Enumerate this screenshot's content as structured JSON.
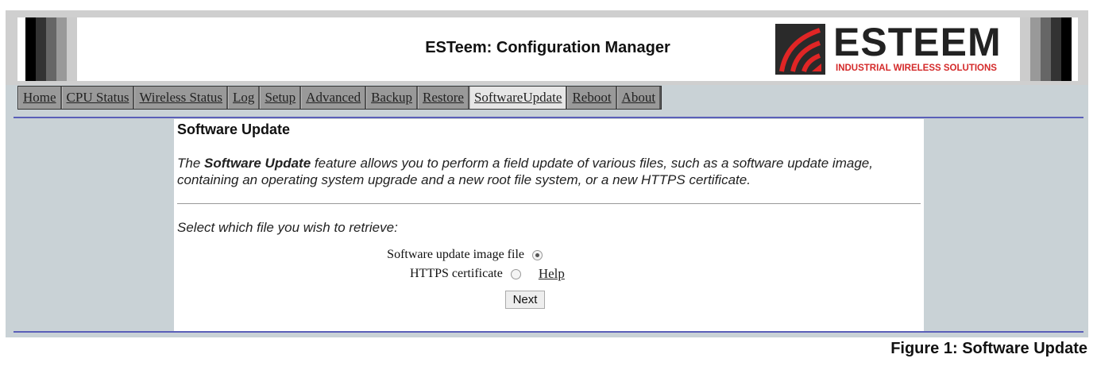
{
  "header": {
    "title": "ESTeem: Configuration Manager",
    "logo_word": "ESTEEM",
    "logo_tagline": "INDUSTRIAL WIRELESS SOLUTIONS"
  },
  "nav": [
    {
      "label": "Home"
    },
    {
      "label": "CPU Status"
    },
    {
      "label": "Wireless Status"
    },
    {
      "label": "Log"
    },
    {
      "label": "Setup"
    },
    {
      "label": "Advanced"
    },
    {
      "label": "Backup"
    },
    {
      "label": "Restore"
    },
    {
      "label": "SoftwareUpdate",
      "active": true
    },
    {
      "label": "Reboot"
    },
    {
      "label": "About"
    }
  ],
  "main": {
    "heading": "Software Update",
    "desc_pre": "The ",
    "desc_bold": "Software Update",
    "desc_post": " feature allows you to perform a field update of various files, such as a software update image, containing an operating system upgrade and a new root file system, or a new HTTPS certificate.",
    "prompt": "Select which file you wish to retrieve:",
    "options": [
      {
        "label": "Software update image file",
        "selected": true
      },
      {
        "label": "HTTPS certificate",
        "selected": false
      }
    ],
    "help": "Help",
    "next": "Next"
  },
  "caption": "Figure 1: Software Update",
  "colors": {
    "accent_line": "#5a5fb8",
    "brand_red": "#d42a2a"
  }
}
